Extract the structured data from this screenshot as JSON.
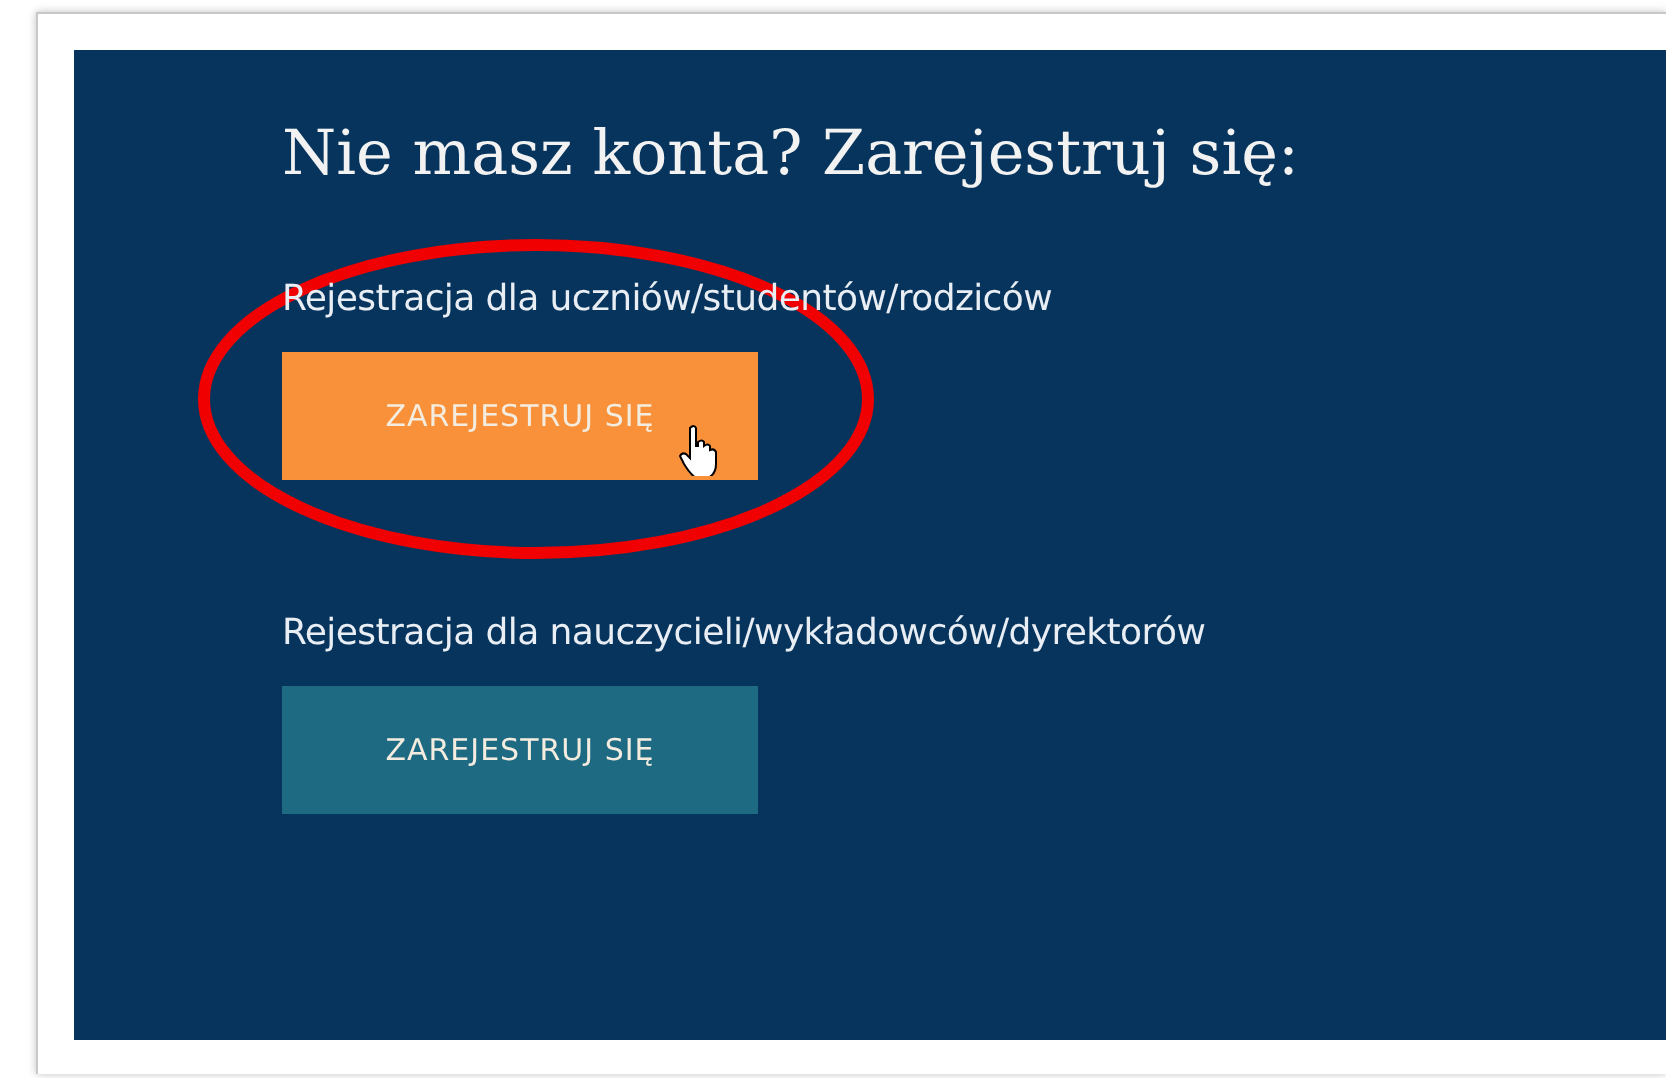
{
  "title": "Nie masz konta? Zarejestruj się:",
  "sections": [
    {
      "label": "Rejestracja dla uczniów/studentów/rodziców",
      "button": "ZAREJESTRUJ SIĘ",
      "color": "#f8913a",
      "pointer": true,
      "circled": true
    },
    {
      "label": "Rejestracja dla nauczycieli/wykładowców/dyrektorów",
      "button": "ZAREJESTRUJ SIĘ",
      "color": "#1e6a82",
      "pointer": false,
      "circled": false
    }
  ]
}
